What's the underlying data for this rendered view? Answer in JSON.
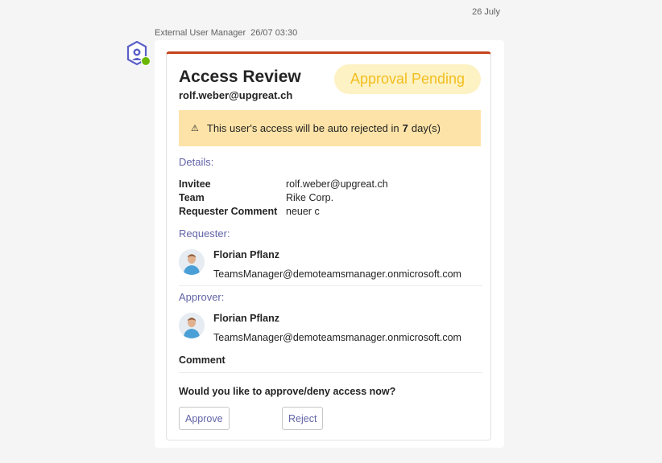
{
  "chat": {
    "date_divider": "26 July",
    "sender": "External User Manager",
    "timestamp": "26/07 03:30",
    "bot_icon": "bot-avatar-icon"
  },
  "card": {
    "accent_color": "#c4441c",
    "title": "Access Review",
    "subtitle": "rolf.weber@upgreat.ch",
    "status": "Approval Pending",
    "warning": {
      "icon": "warning-icon",
      "text_before": "This user's access will be auto rejected in",
      "days": "7",
      "text_after": "day(s)"
    },
    "details_label": "Details:",
    "details": [
      {
        "key": "Invitee",
        "value": "rolf.weber@upgreat.ch"
      },
      {
        "key": "Team",
        "value": "Rike Corp."
      },
      {
        "key": "Requester Comment",
        "value": "neuer c"
      }
    ],
    "requester_label": "Requester:",
    "requester": {
      "name": "Florian Pflanz",
      "email": "TeamsManager@demoteamsmanager.onmicrosoft.com"
    },
    "approver_label": "Approver:",
    "approver": {
      "name": "Florian Pflanz",
      "email": "TeamsManager@demoteamsmanager.onmicrosoft.com"
    },
    "comment_label": "Comment",
    "question": "Would you like to approve/deny access now?",
    "approve_label": "Approve",
    "reject_label": "Reject"
  }
}
